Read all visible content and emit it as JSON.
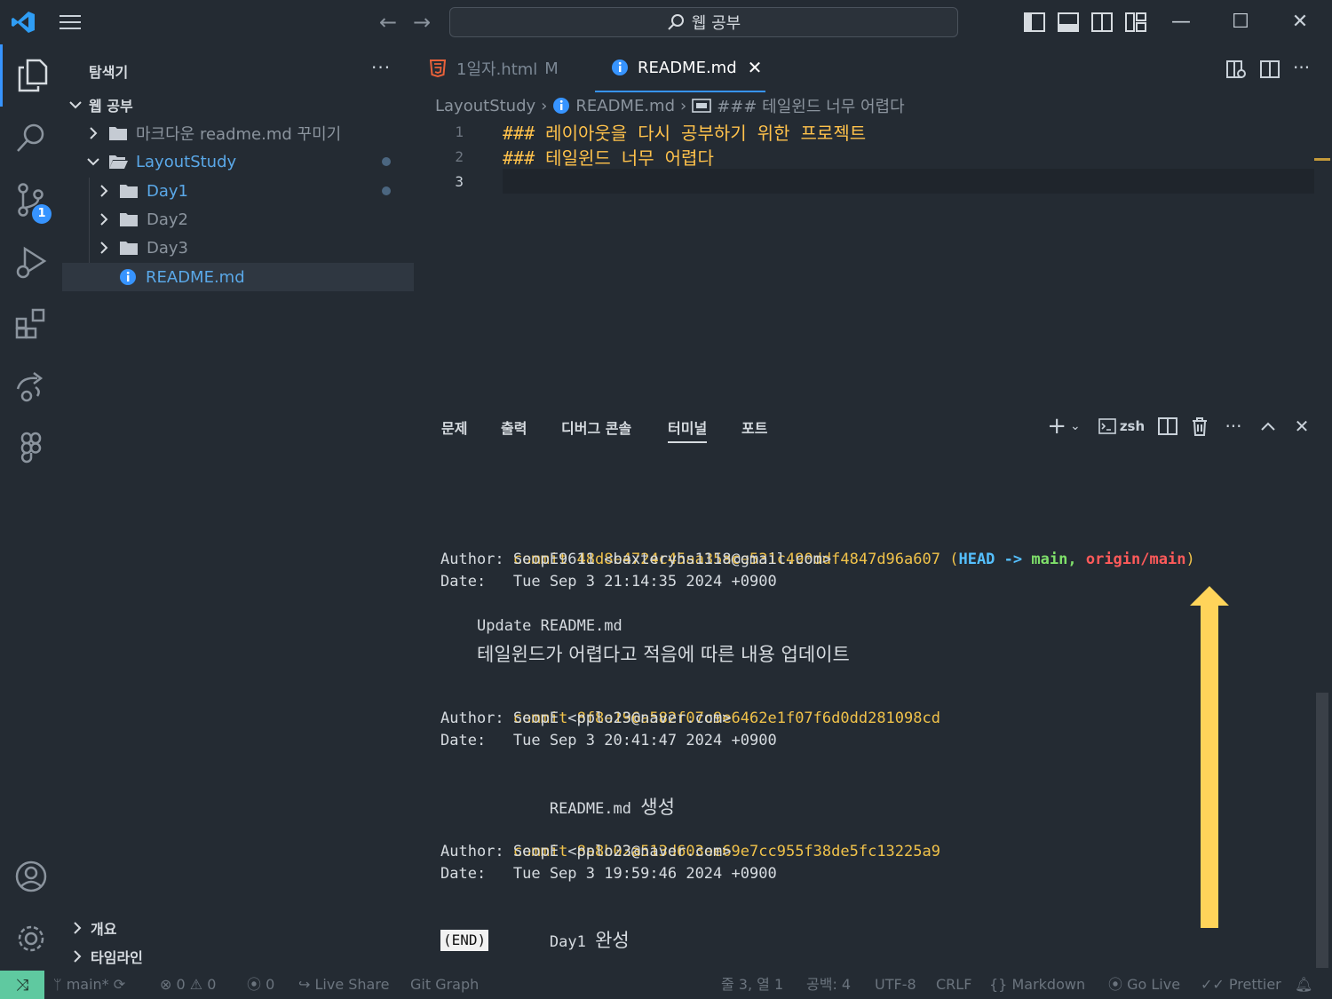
{
  "titlebar": {
    "search_text": "웹 공부"
  },
  "sidebar": {
    "title": "탐색기",
    "more": "···",
    "root_folder": "웹 공부",
    "items": [
      {
        "label": "마크다운 readme.md 꾸미기",
        "type": "folder",
        "expanded": false
      },
      {
        "label": "LayoutStudy",
        "type": "folder",
        "expanded": true
      },
      {
        "label": "Day1",
        "type": "folder",
        "expanded": false
      },
      {
        "label": "Day2",
        "type": "folder",
        "expanded": false
      },
      {
        "label": "Day3",
        "type": "folder",
        "expanded": false
      },
      {
        "label": "README.md",
        "type": "file"
      }
    ],
    "bottom": [
      {
        "label": "개요"
      },
      {
        "label": "타임라인"
      }
    ]
  },
  "activity": {
    "source_control_badge": "1"
  },
  "tabs": [
    {
      "label": "1일자.html",
      "status": "M",
      "active": false
    },
    {
      "label": "README.md",
      "active": true
    }
  ],
  "breadcrumb": {
    "folder": "LayoutStudy",
    "file": "README.md",
    "symbol": "### 테일윈드 너무 어렵다"
  },
  "editor": {
    "lines": [
      {
        "number": "1",
        "text": "### 레이아웃을 다시 공부하기 위한 프로젝트"
      },
      {
        "number": "2",
        "text": "### 테일윈드 너무 어렵다"
      },
      {
        "number": "3",
        "text": ""
      }
    ]
  },
  "panel": {
    "tabs": [
      "문제",
      "출력",
      "디버그 콘솔",
      "터미널",
      "포트"
    ],
    "active_tab": "터미널",
    "shell": "zsh"
  },
  "terminal": {
    "commits": [
      {
        "commit_label": "commit",
        "hash": "48d8e4724c45aa35ace531c490ddf4847d96a607",
        "ref_head": "HEAD",
        "ref_arrow": "->",
        "ref_branch": "main,",
        "ref_origin": "origin/main",
        "author": "Author: SeopE9611 <baxteryhs1118@gmail.com>",
        "date": "Date:   Tue Sep 3 21:14:35 2024 +0900",
        "msg_line1": "Update README.md",
        "msg_line2": "테일윈드가 어렵다고 적음에 따른 내용 업데이트"
      },
      {
        "commit_label": "commit",
        "hash": "8f8e196a582f07c9e6462e1f07f6d0dd281098cd",
        "author": "Author: SeopE <pplo23@naver.com>",
        "date": "Date:   Tue Sep 3 20:41:47 2024 +0900",
        "msg_code": "README.md",
        "msg_kr": "생성"
      },
      {
        "commit_label": "commit",
        "hash": "8a8b02a513d603ee69e7cc955f38de5fc13225a9",
        "author": "Author: SeopE <pplo23@naver.com>",
        "date": "Date:   Tue Sep 3 19:59:46 2024 +0900",
        "msg_code": "Day1",
        "msg_kr": "완성"
      }
    ],
    "end_marker": "(END)"
  },
  "statusbar": {
    "branch": "main*",
    "errors": "0",
    "warnings": "0",
    "ports": "0",
    "live_share": "Live Share",
    "git_graph": "Git Graph",
    "position": "줄 3, 열 1",
    "spaces": "공백: 4",
    "encoding": "UTF-8",
    "eol": "CRLF",
    "language": "Markdown",
    "go_live": "Go Live",
    "prettier": "Prettier"
  },
  "colors": {
    "accent": "#3794ff",
    "remote": "#5fc9a0",
    "arrow": "#ffd45a",
    "heading": "#ffc24b"
  },
  "icons": [
    "vscode-logo-icon",
    "menu-icon",
    "search-icon",
    "explorer-icon",
    "source-control-icon",
    "run-debug-icon",
    "extensions-icon",
    "live-share-icon",
    "figma-icon",
    "account-icon",
    "settings-icon"
  ]
}
